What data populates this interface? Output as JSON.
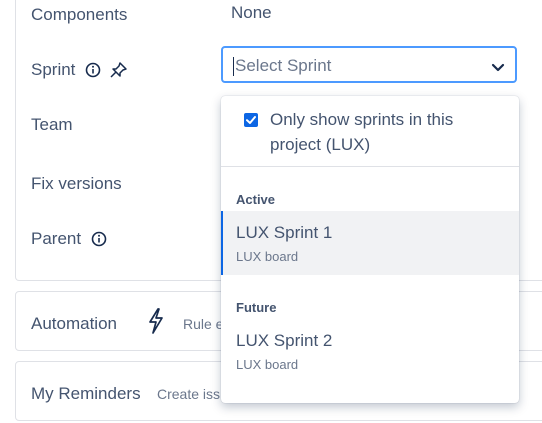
{
  "fields": {
    "components": {
      "label": "Components",
      "value": "None"
    },
    "sprint": {
      "label": "Sprint",
      "placeholder": "Select Sprint"
    },
    "team": {
      "label": "Team"
    },
    "fix_versions": {
      "label": "Fix versions"
    },
    "parent": {
      "label": "Parent"
    }
  },
  "sections": {
    "automation": {
      "title": "Automation",
      "sub": "Rule e"
    },
    "reminders": {
      "title": "My Reminders",
      "sub": "Create iss"
    }
  },
  "dropdown": {
    "checkbox_label_line1": "Only show sprints in this",
    "checkbox_label_line2": "project (LUX)",
    "checkbox_checked": true,
    "groups": [
      {
        "heading": "Active",
        "options": [
          {
            "name": "LUX Sprint 1",
            "board": "LUX board",
            "selected": true
          }
        ]
      },
      {
        "heading": "Future",
        "options": [
          {
            "name": "LUX Sprint 2",
            "board": "LUX board",
            "selected": false
          }
        ]
      }
    ]
  },
  "colors": {
    "accent": "#0c66e4",
    "focus_border": "#4c9aff"
  },
  "icons": [
    "info-icon",
    "pin-icon",
    "chevron-down-icon",
    "lightning-icon",
    "check-icon"
  ]
}
